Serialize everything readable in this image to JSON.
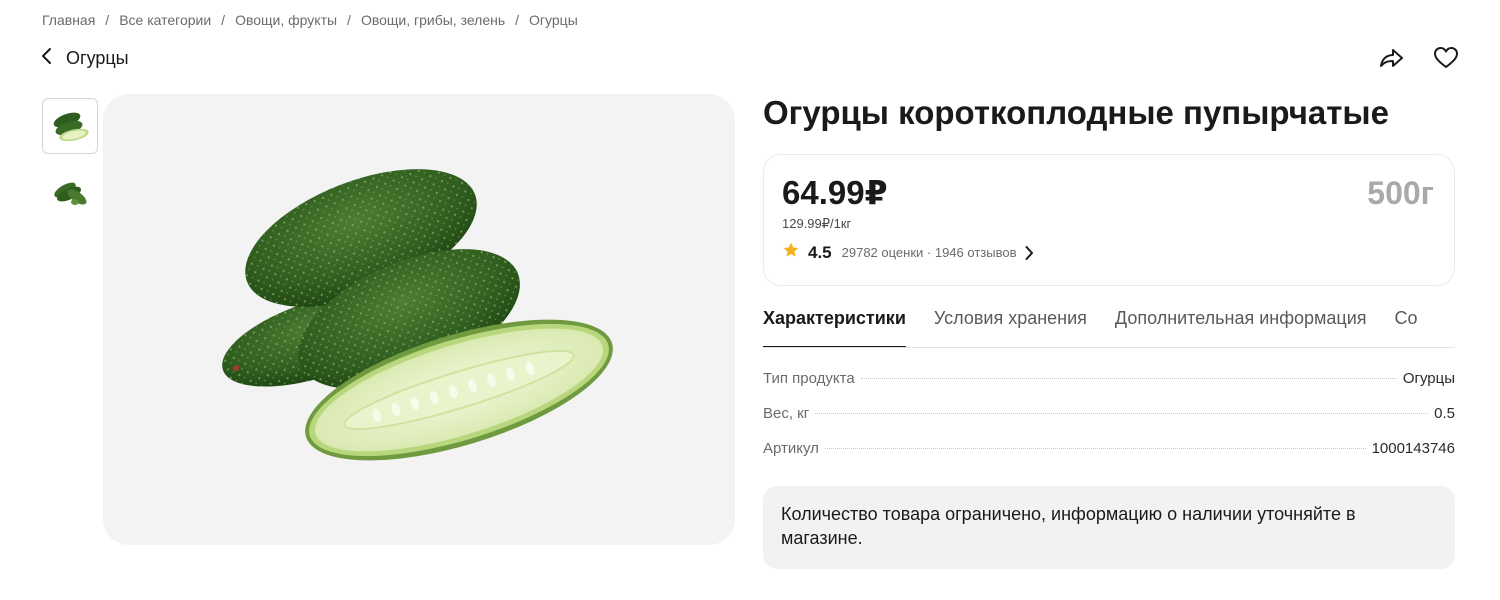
{
  "breadcrumbs": [
    "Главная",
    "Все категории",
    "Овощи, фрукты",
    "Овощи, грибы, зелень",
    "Огурцы"
  ],
  "breadcrumb_separator": "/",
  "header": {
    "back_label": "Огурцы",
    "icons": [
      "chevron-left-icon",
      "share-icon",
      "heart-icon"
    ]
  },
  "product": {
    "title": "Огурцы короткоплодные пупырчатые",
    "price": "64.99₽",
    "unit_price": "129.99₽/1кг",
    "weight": "500г",
    "rating": "4.5",
    "reviews": "29782 оценки · 1946 отзывов"
  },
  "tabs": [
    "Характеристики",
    "Условия хранения",
    "Дополнительная информация",
    "Со"
  ],
  "active_tab": 0,
  "specs": [
    {
      "name": "Тип продукта",
      "value": "Огурцы"
    },
    {
      "name": "Вес, кг",
      "value": "0.5"
    },
    {
      "name": "Артикул",
      "value": "1000143746"
    }
  ],
  "notice": "Количество товара ограничено, информацию о наличии уточняйте в магазине.",
  "colors": {
    "star": "#f5b21b",
    "cucumber_dark": "#2f5d1e",
    "cucumber_flesh": "#e6f2c4",
    "image_bg": "#f3f3f3"
  }
}
